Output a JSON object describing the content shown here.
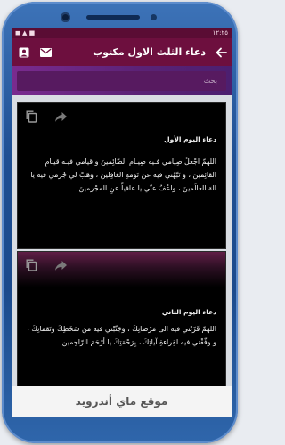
{
  "status": {
    "time": "١٢:٢٥",
    "icons": "◼ ▲ ■"
  },
  "appbar": {
    "title": "دعاء الثلث الاول مكتوب",
    "back_icon": "arrow-left-icon",
    "mail_icon": "mail-icon",
    "account_icon": "account-box-icon"
  },
  "search": {
    "placeholder": "بحث"
  },
  "cards": [
    {
      "title": "دعاء اليوم الأول",
      "body": "اللهمّ اجْعلْ صِيامي فـيه صِيـام الصّائِمينَ و قيامي فيـه قيـامِ القائِمينَ ، و نَبّهْني فيه عن نَومةِ الغافِلينَ ، وهَبْ لي جُرمي فيه يا الهَ العالَمينَ ، واعْفُ عنّي يا عافياً عنِ المجْرمينَ .",
      "copy_icon": "copy-icon",
      "share_icon": "share-icon"
    },
    {
      "title": "دعاء اليوم الثاني",
      "body": "اللهمّ قَرّبْني فيه الى مَرْضاتِكَ ، وجَنّبْني فيه من سَخَطِكَ ونَقماتِكَ ، و وفّقْني فيه لقِراءةِ آياتِكَ ، بِرَحْمَتِكَ يا أرْحَمَ الرّاحِمين .",
      "copy_icon": "copy-icon",
      "share_icon": "share-icon",
      "play_icon": "play-icon"
    }
  ],
  "footer": {
    "watermark": "موقع ماي أندرويد"
  },
  "colors": {
    "appbar": "#6d0f3e",
    "statusbar": "#5a0c34",
    "search_gradient_start": "#7a2b8f",
    "accent_red": "#c62828"
  }
}
